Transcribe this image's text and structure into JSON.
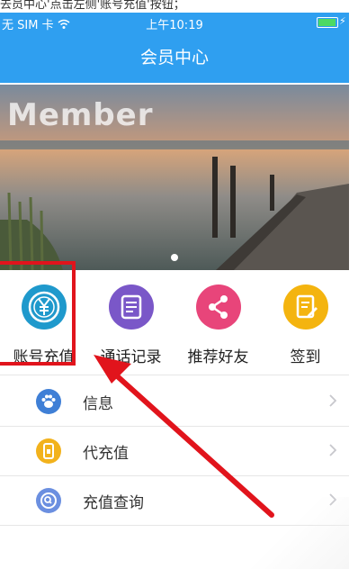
{
  "caption": "去员中心'点击左侧'账号充值'按钮；",
  "status_bar": {
    "carrier": "无 SIM 卡",
    "time": "上午10:19"
  },
  "nav": {
    "title": "会员中心"
  },
  "banner": {
    "text": "Member",
    "active_dot": 1,
    "dot_count": 1
  },
  "grid": [
    {
      "label": "账号充值",
      "icon": "yen-icon",
      "color": "#1f99cc"
    },
    {
      "label": "通话记录",
      "icon": "call-log-icon",
      "color": "#7a57c8"
    },
    {
      "label": "推荐好友",
      "icon": "share-icon",
      "color": "#e8457a"
    },
    {
      "label": "签到",
      "icon": "checkin-icon",
      "color": "#f4b40f"
    }
  ],
  "menu": [
    {
      "label": "信息",
      "icon": "paw-icon",
      "color": "#3f7fd6"
    },
    {
      "label": "代充值",
      "icon": "card-icon",
      "color": "#f2b21c"
    },
    {
      "label": "充值查询",
      "icon": "search-icon",
      "color": "#6b8fe0"
    }
  ],
  "annotation": {
    "highlight_color": "#e1141c"
  }
}
